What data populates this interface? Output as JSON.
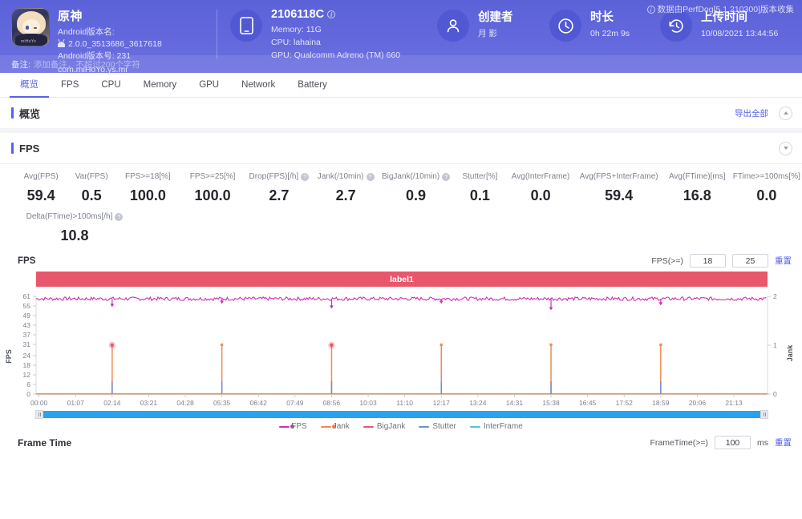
{
  "header": {
    "collect_note": "数据由PerfDog[5.1.210300]版本收集",
    "app": {
      "name": "原神",
      "android_version_name_label": "Android版本名:",
      "android_version_name": "2.0.0_3513686_3617618",
      "android_version_code": "Android版本号: 231",
      "package": "com.miHoYo.ys.mi",
      "icon": "game-app-icon"
    },
    "device": {
      "icon": "phone-icon",
      "model": "2106118C",
      "info_icon": "info-icon",
      "memory": "Memory: 11G",
      "cpu": "CPU: lahaina",
      "gpu": "GPU: Qualcomm Adreno (TM) 660"
    },
    "creator": {
      "icon": "user-icon",
      "title": "创建者",
      "value": "月 影"
    },
    "duration": {
      "icon": "clock-icon",
      "title": "时长",
      "value": "0h 22m 9s"
    },
    "upload": {
      "icon": "history-icon",
      "title": "上传时间",
      "value": "10/08/2021 13:44:56"
    },
    "note": {
      "label": "备注:",
      "placeholder": "添加备注，不超过200个字符"
    }
  },
  "tabs": [
    {
      "label": "概览",
      "active": true
    },
    {
      "label": "FPS",
      "active": false
    },
    {
      "label": "CPU",
      "active": false
    },
    {
      "label": "Memory",
      "active": false
    },
    {
      "label": "GPU",
      "active": false
    },
    {
      "label": "Network",
      "active": false
    },
    {
      "label": "Battery",
      "active": false
    }
  ],
  "overview_section": {
    "title": "概览",
    "export_all": "导出全部",
    "collapse_icon": "chevron-up-icon"
  },
  "fps_section": {
    "title": "FPS",
    "collapse_icon": "chevron-down-icon"
  },
  "metrics_row1": [
    {
      "label": "Avg(FPS)",
      "value": "59.4",
      "help": false
    },
    {
      "label": "Var(FPS)",
      "value": "0.5",
      "help": false
    },
    {
      "label": "FPS>=18[%]",
      "value": "100.0",
      "help": false
    },
    {
      "label": "FPS>=25[%]",
      "value": "100.0",
      "help": false
    },
    {
      "label": "Drop(FPS)[/h]",
      "value": "2.7",
      "help": true
    },
    {
      "label": "Jank(/10min)",
      "value": "2.7",
      "help": true
    },
    {
      "label": "BigJank(/10min)",
      "value": "0.9",
      "help": true
    },
    {
      "label": "Stutter[%]",
      "value": "0.1",
      "help": false
    },
    {
      "label": "Avg(InterFrame)",
      "value": "0.0",
      "help": false
    },
    {
      "label": "Avg(FPS+InterFrame)",
      "value": "59.4",
      "help": false
    },
    {
      "label": "Avg(FTime)[ms]",
      "value": "16.8",
      "help": false
    },
    {
      "label": "FTime>=100ms[%]",
      "value": "0.0",
      "help": false
    }
  ],
  "metrics_row2": [
    {
      "label": "Delta(FTime)>100ms[/h]",
      "value": "10.8",
      "help": true
    }
  ],
  "fps_chart": {
    "name": "FPS",
    "threshold_label": "FPS(>=)",
    "threshold1": "18",
    "threshold2": "25",
    "reset": "重置",
    "label_bar": "label1"
  },
  "frame_time": {
    "title": "Frame Time",
    "threshold_label": "FrameTime(>=)",
    "threshold": "100",
    "unit": "ms",
    "reset": "重置"
  },
  "chart_data": {
    "type": "line",
    "title": "FPS",
    "xlabel": "",
    "ylabel": "FPS",
    "y2label": "Jank",
    "ylim": [
      0,
      61
    ],
    "y2lim": [
      0,
      2
    ],
    "grid": false,
    "legend_position": "bottom",
    "yticks": [
      0,
      6,
      12,
      18,
      24,
      31,
      37,
      43,
      49,
      55,
      61
    ],
    "y2ticks": [
      0,
      1,
      2
    ],
    "xticks": [
      "00:00",
      "01:07",
      "02:14",
      "03:21",
      "04:28",
      "05:35",
      "06:42",
      "07:49",
      "08:56",
      "10:03",
      "11:10",
      "12:17",
      "13:24",
      "14:31",
      "15:38",
      "16:45",
      "17:52",
      "18:59",
      "20:06",
      "21:13"
    ],
    "colors": {
      "FPS": "#cc31b4",
      "Jank": "#f08a50",
      "BigJank": "#e8576b",
      "Stutter": "#6d8fd8",
      "InterFrame": "#49c7e0",
      "axis": "#c8a489"
    },
    "series": [
      {
        "name": "FPS",
        "type": "line",
        "color": "#cc31b4",
        "description": "Near-constant ~59-60 fps baseline over the whole 22 minute run, with occasional short dips",
        "baseline": 59.4,
        "dips": [
          {
            "time": "02:14",
            "value": 55
          },
          {
            "time": "05:35",
            "value": 57
          },
          {
            "time": "08:56",
            "value": 54
          },
          {
            "time": "12:17",
            "value": 57
          },
          {
            "time": "15:38",
            "value": 53
          },
          {
            "time": "18:59",
            "value": 56
          }
        ]
      },
      {
        "name": "Jank",
        "type": "bar",
        "color": "#f08a50",
        "description": "Discrete jank events plotted against the right Jank axis",
        "events": [
          {
            "time": "02:14",
            "value": 1
          },
          {
            "time": "05:35",
            "value": 1
          },
          {
            "time": "08:56",
            "value": 1
          },
          {
            "time": "12:17",
            "value": 1
          },
          {
            "time": "15:38",
            "value": 1
          },
          {
            "time": "18:59",
            "value": 1
          }
        ]
      },
      {
        "name": "BigJank",
        "type": "scatter",
        "color": "#e8576b",
        "description": "Big jank markers (red dots) at a subset of the jank events",
        "events": [
          {
            "time": "02:14",
            "value": 1
          },
          {
            "time": "08:56",
            "value": 1
          }
        ]
      },
      {
        "name": "Stutter",
        "type": "bar",
        "color": "#6d8fd8",
        "description": "Small stutter bars at the base of each jank event",
        "events": [
          {
            "time": "02:14",
            "value": 0.1
          },
          {
            "time": "05:35",
            "value": 0.1
          },
          {
            "time": "08:56",
            "value": 0.1
          },
          {
            "time": "12:17",
            "value": 0.1
          },
          {
            "time": "15:38",
            "value": 0.1
          },
          {
            "time": "18:59",
            "value": 0.1
          }
        ]
      },
      {
        "name": "InterFrame",
        "type": "line",
        "color": "#49c7e0",
        "description": "Flat at zero for the whole capture",
        "values": [
          0
        ]
      }
    ],
    "legend": [
      {
        "name": "FPS",
        "color": "#cc31b4"
      },
      {
        "name": "Jank",
        "color": "#f08a50"
      },
      {
        "name": "BigJank",
        "color": "#e8576b"
      },
      {
        "name": "Stutter",
        "color": "#6d8fd8"
      },
      {
        "name": "InterFrame",
        "color": "#49c7e0"
      }
    ]
  }
}
